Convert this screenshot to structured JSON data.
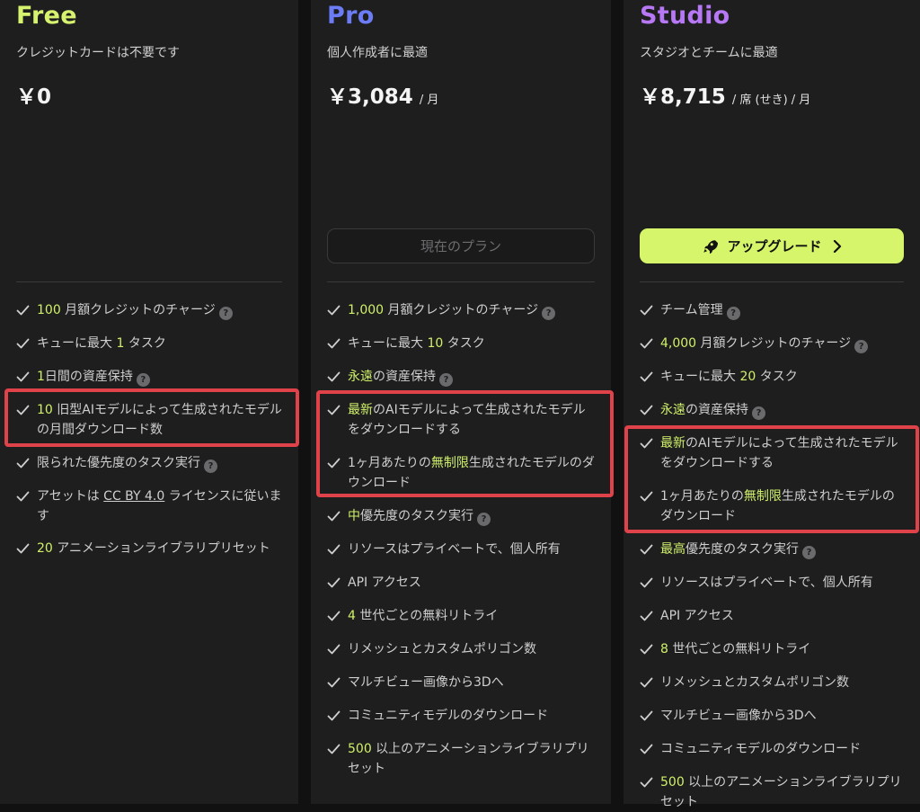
{
  "plans": {
    "free": {
      "name": "Free",
      "name_color": "#d6f26e",
      "subtitle": "クレジットカードは不要です",
      "price": "￥0",
      "unit": "",
      "features": [
        {
          "hl": "100",
          "text": " 月額クレジットのチャージ",
          "q": true
        },
        {
          "pre": "キューに最大 ",
          "hl": "1",
          "text": " タスク"
        },
        {
          "hl": "1",
          "text": "日間の資産保持",
          "q": true
        },
        {
          "hl": "10",
          "text": " 旧型AIモデルによって生成されたモデルの月間ダウンロード数"
        },
        {
          "text": "限られた優先度のタスク実行",
          "q": true
        },
        {
          "pre": "アセットは ",
          "link": "CC BY 4.0",
          "text": " ライセンスに従います"
        },
        {
          "hl": "20",
          "text": " アニメーションライブラリプリセット"
        }
      ]
    },
    "pro": {
      "name": "Pro",
      "name_color": "#6b7cf5",
      "subtitle": "個人作成者に最適",
      "price": "￥3,084",
      "unit": "/ 月",
      "button": "現在のプラン",
      "features": [
        {
          "hl": "1,000",
          "text": " 月額クレジットのチャージ",
          "q": true
        },
        {
          "pre": "キューに最大 ",
          "hl": "10",
          "text": " タスク"
        },
        {
          "hl": "永遠",
          "text": "の資産保持",
          "q": true
        },
        {
          "hl": "最新",
          "text": "のAIモデルによって生成されたモデルをダウンロードする"
        },
        {
          "pre": "1ヶ月あたりの",
          "hl": "無制限",
          "text": "生成されたモデルのダウンロード"
        },
        {
          "hl": "中",
          "text": "優先度のタスク実行",
          "q": true
        },
        {
          "text": "リソースはプライベートで、個人所有"
        },
        {
          "text": "API アクセス"
        },
        {
          "hl": "4",
          "text": " 世代ごとの無料リトライ"
        },
        {
          "text": "リメッシュとカスタムポリゴン数"
        },
        {
          "text": "マルチビュー画像から3Dへ"
        },
        {
          "text": "コミュニティモデルのダウンロード"
        },
        {
          "hl": "500",
          "text": " 以上のアニメーションライブラリプリセット"
        }
      ]
    },
    "studio": {
      "name": "Studio",
      "name_color": "#b778f5",
      "subtitle": "スタジオとチームに最適",
      "price": "￥8,715",
      "unit": "/ 席 (せき) / 月",
      "button": "アップグレード",
      "button_color": "#d6f56a",
      "features": [
        {
          "text": "チーム管理",
          "q": true
        },
        {
          "hl": "4,000",
          "text": " 月額クレジットのチャージ",
          "q": true
        },
        {
          "pre": "キューに最大 ",
          "hl": "20",
          "text": " タスク"
        },
        {
          "hl": "永遠",
          "text": "の資産保持",
          "q": true
        },
        {
          "hl": "最新",
          "text": "のAIモデルによって生成されたモデルをダウンロードする"
        },
        {
          "pre": "1ヶ月あたりの",
          "hl": "無制限",
          "text": "生成されたモデルのダウンロード"
        },
        {
          "hl": "最高",
          "text": "優先度のタスク実行",
          "q": true
        },
        {
          "text": "リソースはプライベートで、個人所有"
        },
        {
          "text": "API アクセス"
        },
        {
          "hl": "8",
          "text": " 世代ごとの無料リトライ"
        },
        {
          "text": "リメッシュとカスタムポリゴン数"
        },
        {
          "text": "マルチビュー画像から3Dへ"
        },
        {
          "text": "コミュニティモデルのダウンロード"
        },
        {
          "hl": "500",
          "text": " 以上のアニメーションライブラリプリセット"
        }
      ]
    }
  },
  "icons": {
    "check": "check-icon",
    "help": "question-icon",
    "rocket": "rocket-icon",
    "chevron": "chevron-right-icon"
  },
  "annotation_color": "#e0424a"
}
